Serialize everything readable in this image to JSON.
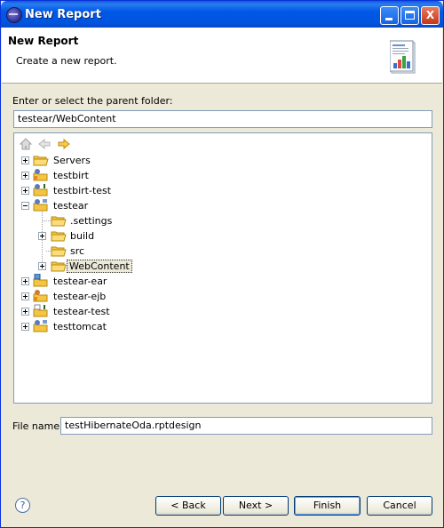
{
  "window": {
    "title": "New Report",
    "controls": {
      "minimize_icon": "minimize-icon",
      "maximize_icon": "maximize-icon",
      "close_label": "X"
    }
  },
  "header": {
    "title": "New Report",
    "description": "Create a new report.",
    "icon": "report-wizard-icon"
  },
  "parent_folder": {
    "label": "Enter or select the parent folder:",
    "value": "testear/WebContent"
  },
  "tree": {
    "nav": {
      "home_icon": "home-icon",
      "back_icon": "back-arrow-icon",
      "forward_icon": "forward-arrow-icon"
    },
    "items": [
      {
        "label": "Servers",
        "expander": "plus",
        "icon": "folder-icon"
      },
      {
        "label": "testbirt",
        "expander": "plus",
        "icon": "project-icon"
      },
      {
        "label": "testbirt-test",
        "expander": "plus",
        "icon": "project-icon"
      },
      {
        "label": "testear",
        "expander": "minus",
        "icon": "project-icon"
      },
      {
        "label": ".settings",
        "expander": "",
        "icon": "folder-icon"
      },
      {
        "label": "build",
        "expander": "plus",
        "icon": "folder-icon"
      },
      {
        "label": "src",
        "expander": "",
        "icon": "folder-icon"
      },
      {
        "label": "WebContent",
        "expander": "plus",
        "icon": "folder-icon",
        "selected": true
      },
      {
        "label": "testear-ear",
        "expander": "plus",
        "icon": "ear-project-icon"
      },
      {
        "label": "testear-ejb",
        "expander": "plus",
        "icon": "ejb-project-icon"
      },
      {
        "label": "testear-test",
        "expander": "plus",
        "icon": "project-icon"
      },
      {
        "label": "testtomcat",
        "expander": "plus",
        "icon": "project-icon"
      }
    ]
  },
  "file_name": {
    "label": "File name:",
    "value": "testHibernateOda.rptdesign"
  },
  "buttons": {
    "help": "?",
    "back": "< Back",
    "next": "Next >",
    "finish": "Finish",
    "cancel": "Cancel"
  },
  "colors": {
    "title_bar": "#0055e0",
    "dialog_bg": "#ece9d8",
    "field_border": "#7f9db9",
    "folder_yellow": "#f5c542"
  }
}
